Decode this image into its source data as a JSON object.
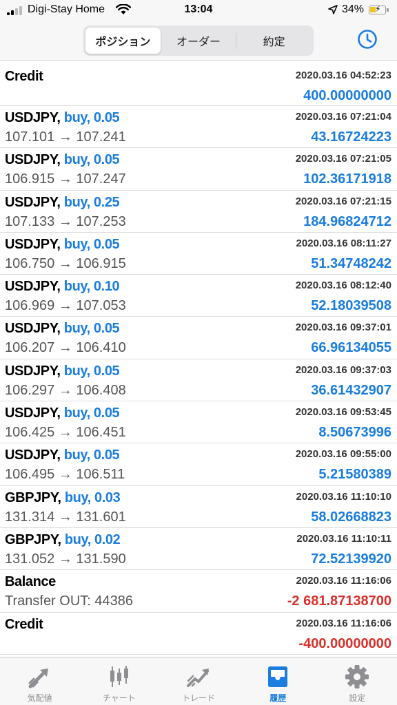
{
  "status_bar": {
    "carrier": "Digi-Stay Home",
    "time": "13:04",
    "battery": "34%"
  },
  "header": {
    "tabs": [
      {
        "label": "ポジション",
        "active": true
      },
      {
        "label": "オーダー",
        "active": false
      },
      {
        "label": "約定",
        "active": false
      }
    ],
    "history_icon": "clock-icon"
  },
  "rows": [
    {
      "symbol": "Credit",
      "side": "",
      "timestamp": "2020.03.16 04:52:23",
      "detail": "",
      "profit": "400.00000000",
      "negative": false
    },
    {
      "symbol": "USDJPY,",
      "side": "buy, 0.05",
      "timestamp": "2020.03.16 07:21:04",
      "detail": "107.101 → 107.241",
      "profit": "43.16724223",
      "negative": false
    },
    {
      "symbol": "USDJPY,",
      "side": "buy, 0.05",
      "timestamp": "2020.03.16 07:21:05",
      "detail": "106.915 → 107.247",
      "profit": "102.36171918",
      "negative": false
    },
    {
      "symbol": "USDJPY,",
      "side": "buy, 0.25",
      "timestamp": "2020.03.16 07:21:15",
      "detail": "107.133 → 107.253",
      "profit": "184.96824712",
      "negative": false
    },
    {
      "symbol": "USDJPY,",
      "side": "buy, 0.05",
      "timestamp": "2020.03.16 08:11:27",
      "detail": "106.750 → 106.915",
      "profit": "51.34748242",
      "negative": false
    },
    {
      "symbol": "USDJPY,",
      "side": "buy, 0.10",
      "timestamp": "2020.03.16 08:12:40",
      "detail": "106.969 → 107.053",
      "profit": "52.18039508",
      "negative": false
    },
    {
      "symbol": "USDJPY,",
      "side": "buy, 0.05",
      "timestamp": "2020.03.16 09:37:01",
      "detail": "106.207 → 106.410",
      "profit": "66.96134055",
      "negative": false
    },
    {
      "symbol": "USDJPY,",
      "side": "buy, 0.05",
      "timestamp": "2020.03.16 09:37:03",
      "detail": "106.297 → 106.408",
      "profit": "36.61432907",
      "negative": false
    },
    {
      "symbol": "USDJPY,",
      "side": "buy, 0.05",
      "timestamp": "2020.03.16 09:53:45",
      "detail": "106.425 → 106.451",
      "profit": "8.50673996",
      "negative": false
    },
    {
      "symbol": "USDJPY,",
      "side": "buy, 0.05",
      "timestamp": "2020.03.16 09:55:00",
      "detail": "106.495 → 106.511",
      "profit": "5.21580389",
      "negative": false
    },
    {
      "symbol": "GBPJPY,",
      "side": "buy, 0.03",
      "timestamp": "2020.03.16 11:10:10",
      "detail": "131.314 → 131.601",
      "profit": "58.02668823",
      "negative": false
    },
    {
      "symbol": "GBPJPY,",
      "side": "buy, 0.02",
      "timestamp": "2020.03.16 11:10:11",
      "detail": "131.052 → 131.590",
      "profit": "72.52139920",
      "negative": false
    },
    {
      "symbol": "Balance",
      "side": "",
      "timestamp": "2020.03.16 11:16:06",
      "detail": "Transfer OUT: 44386",
      "profit": "-2 681.87138700",
      "negative": true
    },
    {
      "symbol": "Credit",
      "side": "",
      "timestamp": "2020.03.16 11:16:06",
      "detail": "",
      "profit": "-400.00000000",
      "negative": true
    }
  ],
  "tabbar": [
    {
      "label": "気配値",
      "icon": "quotes-arrows-icon",
      "active": false
    },
    {
      "label": "チャート",
      "icon": "candlestick-chart-icon",
      "active": false
    },
    {
      "label": "トレード",
      "icon": "trade-trend-icon",
      "active": false
    },
    {
      "label": "履歴",
      "icon": "history-inbox-icon",
      "active": true
    },
    {
      "label": "設定",
      "icon": "gear-icon",
      "active": false
    }
  ],
  "colors": {
    "accent": "#1a7de0",
    "negative": "#d9302b",
    "bar_bg": "#f7f7f7"
  }
}
